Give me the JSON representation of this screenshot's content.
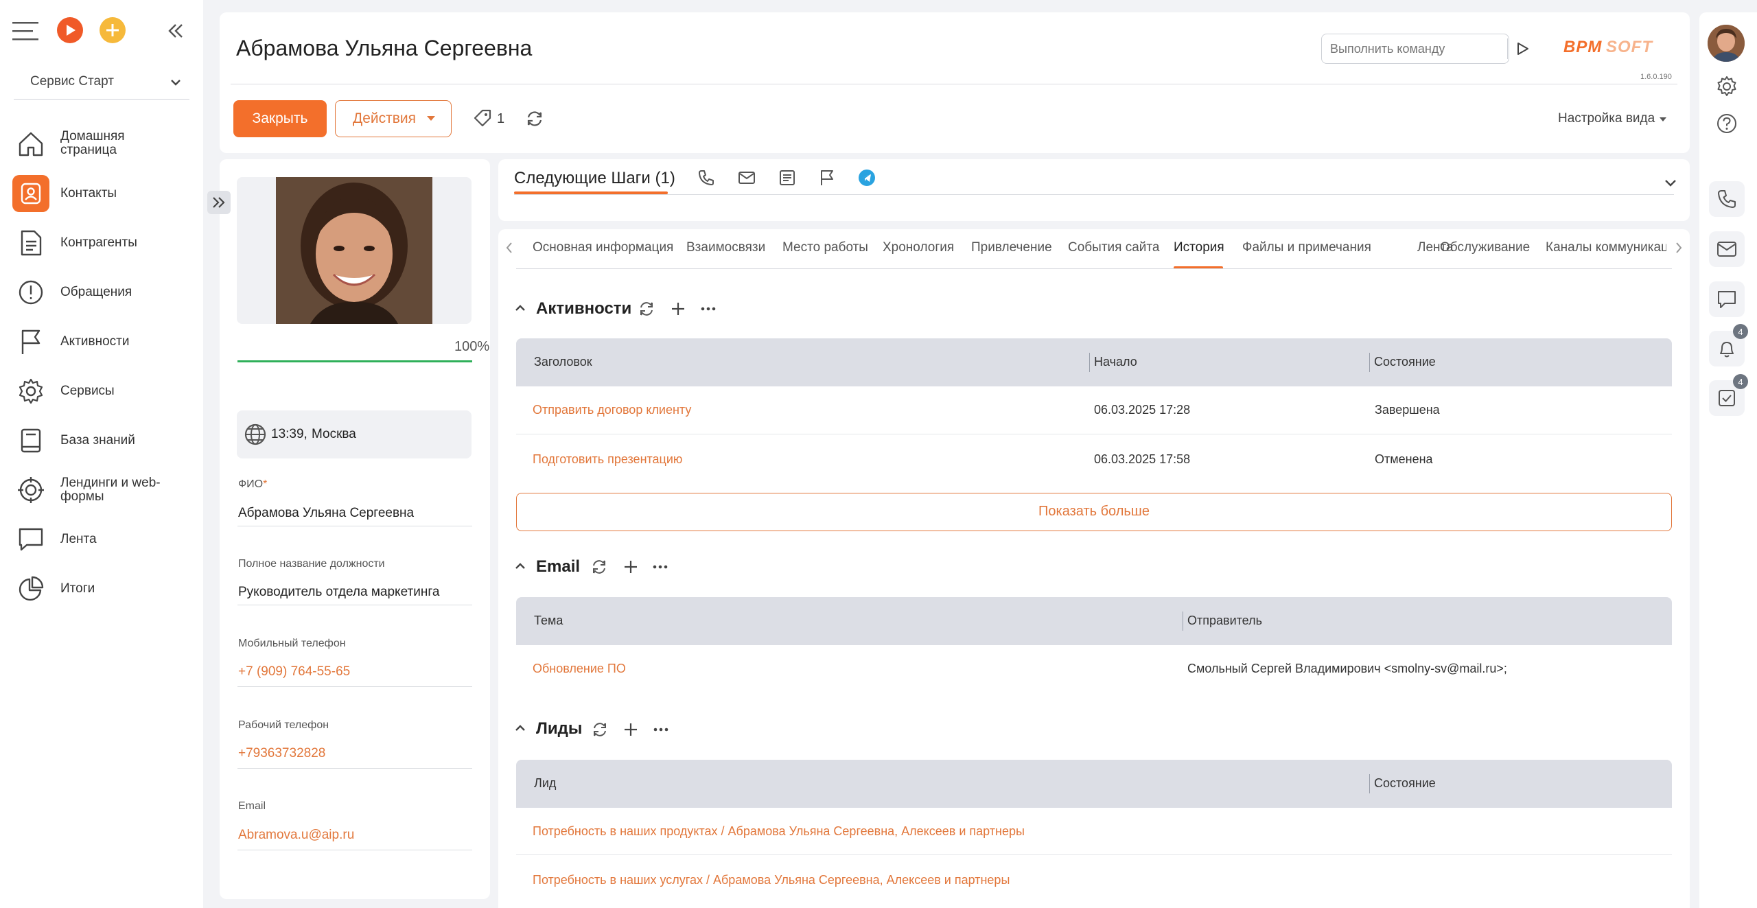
{
  "sidebar": {
    "workspace": "Сервис Старт",
    "items": [
      {
        "label": "Домашняя страница",
        "icon": "home-icon"
      },
      {
        "label": "Контакты",
        "icon": "contact-icon"
      },
      {
        "label": "Контрагенты",
        "icon": "document-icon"
      },
      {
        "label": "Обращения",
        "icon": "alert-icon"
      },
      {
        "label": "Активности",
        "icon": "flag-icon"
      },
      {
        "label": "Сервисы",
        "icon": "gear-icon"
      },
      {
        "label": "База знаний",
        "icon": "book-icon"
      },
      {
        "label": "Лендинги и web-формы",
        "icon": "target-icon"
      },
      {
        "label": "Лента",
        "icon": "chat-icon"
      },
      {
        "label": "Итоги",
        "icon": "pie-chart-icon"
      }
    ]
  },
  "header": {
    "title": "Абрамова Ульяна Сергеевна",
    "command_placeholder": "Выполнить команду",
    "logo": "BPMSOFT",
    "version": "1.6.0.190",
    "close_label": "Закрыть",
    "actions_label": "Действия",
    "tags_count": "1",
    "view_settings_label": "Настройка вида"
  },
  "profile": {
    "completeness": "100%",
    "completeness_value": 1.0,
    "time": "13:39,",
    "city": "Москва",
    "fields": [
      {
        "label": "ФИО",
        "required": "*",
        "value": "Абрамова Ульяна Сергеевна"
      },
      {
        "label": "Полное название должности",
        "value": "Руководитель отдела маркетинга"
      },
      {
        "label": "Мобильный телефон",
        "value": "+7 (909) 764-55-65"
      },
      {
        "label": "Рабочий телефон",
        "value": "+79363732828"
      },
      {
        "label": "Email",
        "value": "Abramova.u@aip.ru"
      }
    ]
  },
  "next_steps": {
    "title": "Следующие Шаги (1)"
  },
  "tabs": [
    "Основная информация",
    "Взаимосвязи",
    "Место работы",
    "Хронология",
    "Привлечение",
    "События сайта",
    "История",
    "Файлы и примечания",
    "Лента",
    "Обслуживание",
    "Каналы коммуникаций"
  ],
  "activities": {
    "title": "Активности",
    "columns": [
      "Заголовок",
      "Начало",
      "Состояние"
    ],
    "rows": [
      {
        "title": "Отправить договор клиенту",
        "start": "06.03.2025 17:28",
        "state": "Завершена"
      },
      {
        "title": "Подготовить презентацию",
        "start": "06.03.2025 17:58",
        "state": "Отменена"
      }
    ],
    "show_more": "Показать больше"
  },
  "email": {
    "title": "Email",
    "columns": [
      "Тема",
      "Отправитель"
    ],
    "rows": [
      {
        "subject": "Обновление ПО",
        "sender": "Смольный Сергей Владимирович <smolny-sv@mail.ru>;"
      }
    ]
  },
  "leads": {
    "title": "Лиды",
    "columns": [
      "Лид",
      "Состояние"
    ],
    "rows": [
      {
        "lead": "Потребность в наших продуктах / Абрамова Ульяна Сергеевна, Алексеев и партнеры"
      },
      {
        "lead": "Потребность в наших услугах / Абрамова Ульяна Сергеевна, Алексеев и партнеры"
      }
    ]
  },
  "right_bar": {
    "notifications_count": "4",
    "tasks_count": "4"
  },
  "colors": {
    "accent": "#f36f2b",
    "link": "#e2773b",
    "telegram": "#2aa3e0",
    "progress": "#2fb05a"
  }
}
